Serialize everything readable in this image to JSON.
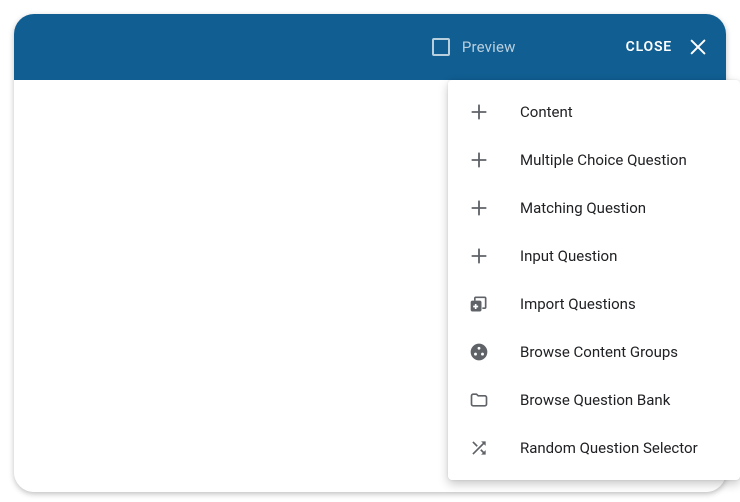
{
  "header": {
    "preview_label": "Preview",
    "close_label": "CLOSE"
  },
  "menu": {
    "items": [
      {
        "icon": "plus-icon",
        "label": "Content"
      },
      {
        "icon": "plus-icon",
        "label": "Multiple Choice Question"
      },
      {
        "icon": "plus-icon",
        "label": "Matching Question"
      },
      {
        "icon": "plus-icon",
        "label": "Input Question"
      },
      {
        "icon": "import-icon",
        "label": "Import Questions"
      },
      {
        "icon": "groups-icon",
        "label": "Browse Content Groups"
      },
      {
        "icon": "folder-icon",
        "label": "Browse Question Bank"
      },
      {
        "icon": "shuffle-icon",
        "label": "Random Question Selector"
      }
    ]
  }
}
